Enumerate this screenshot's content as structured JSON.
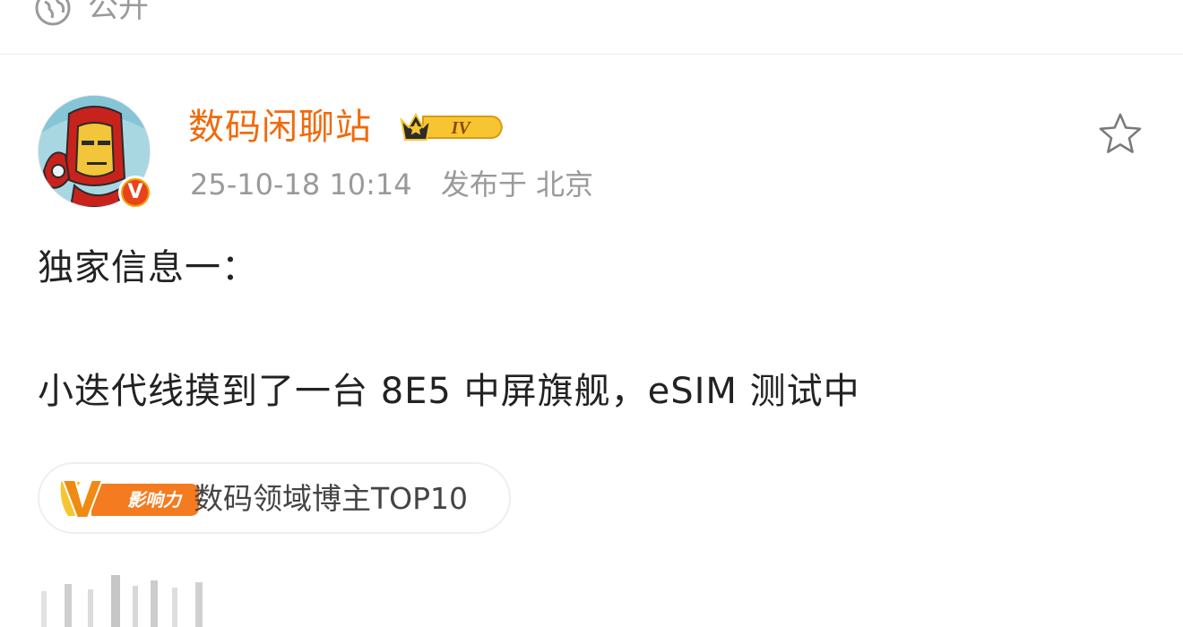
{
  "visibility": {
    "label": "公开",
    "icon": "globe-icon"
  },
  "post": {
    "author": {
      "name": "数码闲聊站",
      "level": "IV",
      "verified_mark": "V",
      "name_color": "#f06a0c"
    },
    "timestamp": "25-10-18 10:14",
    "location": "发布于 北京",
    "favorite_icon": "star-outline-icon",
    "text_line1": "独家信息一：",
    "text_line2": "小迭代线摸到了一台 8E5 中屏旗舰，eSIM 测试中"
  },
  "influence_tag": {
    "badge_letter": "V",
    "badge_text": "影响力",
    "label": "数码领域博主TOP10"
  }
}
